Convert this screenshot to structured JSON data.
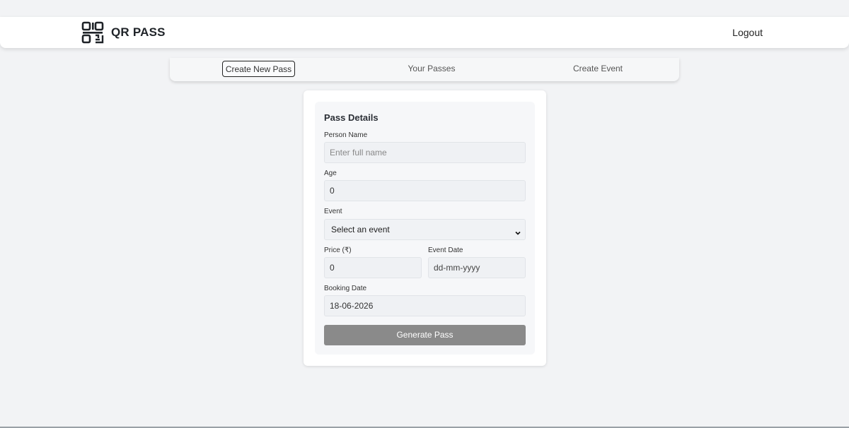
{
  "app": {
    "name": "QR PASS",
    "logo_icon": "qr-code-icon"
  },
  "nav": {
    "logout_label": "Logout"
  },
  "tabs": [
    {
      "label": "Create New Pass",
      "active": true
    },
    {
      "label": "Your Passes",
      "active": false
    },
    {
      "label": "Create Event",
      "active": false
    }
  ],
  "form": {
    "title": "Pass Details",
    "person_name": {
      "label": "Person Name",
      "placeholder": "Enter full name",
      "value": ""
    },
    "age": {
      "label": "Age",
      "value": "0"
    },
    "event": {
      "label": "Event",
      "selected": "Select an event"
    },
    "price": {
      "label": "Price (₹)",
      "value": "0"
    },
    "event_date": {
      "label": "Event Date",
      "placeholder": "dd-mm-yyyy"
    },
    "booking_date": {
      "label": "Booking Date",
      "value": "18-06-2026"
    },
    "submit_label": "Generate Pass"
  },
  "colors": {
    "button": "#8a8a8a",
    "background": "#f2f3f5"
  }
}
